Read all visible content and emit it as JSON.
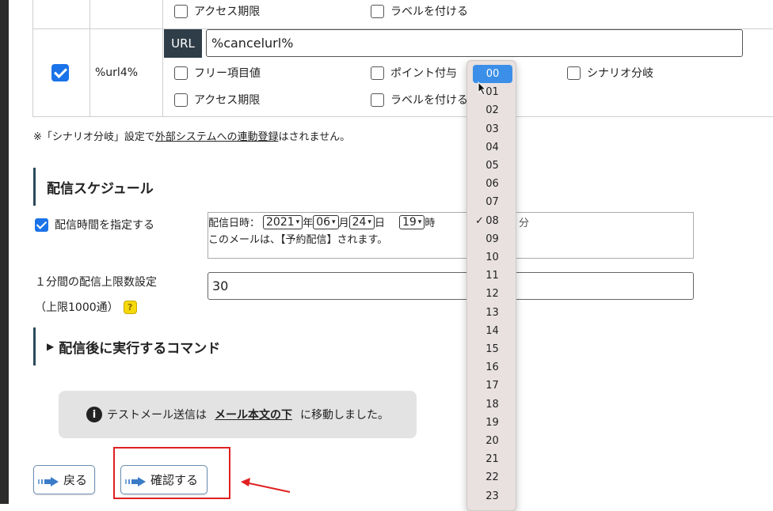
{
  "table": {
    "row_top": {
      "options": [
        "アクセス期限",
        "ラベルを付ける"
      ]
    },
    "row_url": {
      "variable": "%url4%",
      "url_tag": "URL",
      "url_value": "%cancelurl%",
      "options": [
        "フリー項目値",
        "ポイント付与",
        "シナリオ分岐",
        "アクセス期限",
        "ラベルを付ける"
      ]
    }
  },
  "note": {
    "prefix": "※「シナリオ分岐」設定で",
    "link": "外部システムへの連動登録",
    "suffix": "はされません。"
  },
  "schedule": {
    "title": "配信スケジュール",
    "specify_time_label": "配信時間を指定する",
    "date_label": "配信日時：",
    "year": "2021",
    "year_unit": "年",
    "month": "06",
    "month_unit": "月",
    "day": "24",
    "day_unit": "日",
    "hour": "19",
    "hour_unit_partial": "時",
    "minute_unit_partial": "分",
    "message": "このメールは、【予約配信】されます。"
  },
  "limit": {
    "label": "１分間の配信上限数設定",
    "sublabel": "（上限1000通）",
    "help_icon": "?",
    "value": "30"
  },
  "command": {
    "title": "配信後に実行するコマンド"
  },
  "info": {
    "prefix": "テストメール送信は",
    "link": "メール本文の下",
    "suffix": "に移動しました。"
  },
  "buttons": {
    "back": "戻る",
    "confirm": "確認する"
  },
  "minute_dropdown": {
    "options": [
      "00",
      "01",
      "02",
      "03",
      "04",
      "05",
      "06",
      "07",
      "08",
      "09",
      "10",
      "11",
      "12",
      "13",
      "14",
      "15",
      "16",
      "17",
      "18",
      "19",
      "20",
      "21",
      "22",
      "23"
    ],
    "highlighted": "00",
    "checked": "08"
  },
  "colors": {
    "checkbox_blue": "#1a73e8",
    "annotation_red": "#e02020",
    "dropdown_highlight": "#3b8fe8"
  }
}
